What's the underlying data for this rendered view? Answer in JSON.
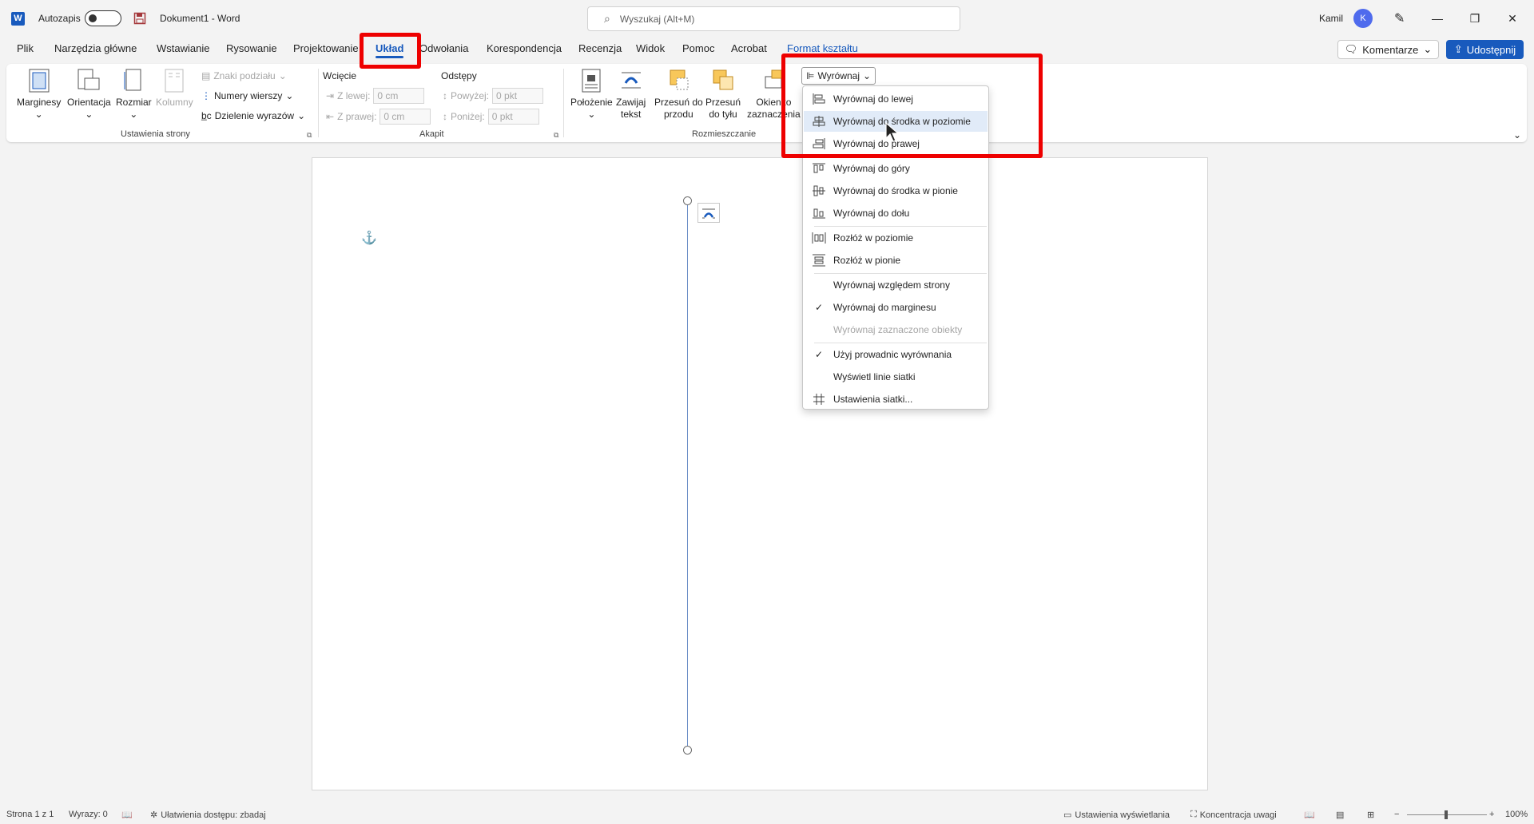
{
  "titlebar": {
    "app_logo": "W",
    "autosave_label": "Autozapis",
    "autosave_state": "off",
    "document_title": "Dokument1  -  Word",
    "search_placeholder": "Wyszukaj (Alt+M)",
    "user_name": "Kamil",
    "user_initial": "K"
  },
  "tabs": [
    {
      "label": "Plik"
    },
    {
      "label": "Narzędzia główne"
    },
    {
      "label": "Wstawianie"
    },
    {
      "label": "Rysowanie"
    },
    {
      "label": "Projektowanie"
    },
    {
      "label": "Układ",
      "active": true
    },
    {
      "label": "Odwołania"
    },
    {
      "label": "Korespondencja"
    },
    {
      "label": "Recenzja"
    },
    {
      "label": "Widok"
    },
    {
      "label": "Pomoc"
    },
    {
      "label": "Acrobat"
    },
    {
      "label": "Format kształtu",
      "contextual": true
    }
  ],
  "actions": {
    "comments": "Komentarze",
    "share": "Udostępnij"
  },
  "ribbon": {
    "page_setup": {
      "margins": "Marginesy",
      "orientation": "Orientacja",
      "size": "Rozmiar",
      "columns": "Kolumny",
      "breaks": "Znaki podziału",
      "line_numbers": "Numery wierszy",
      "hyphenation": "Dzielenie wyrazów",
      "group_label": "Ustawienia strony"
    },
    "paragraph": {
      "indent_title": "Wcięcie",
      "indent_left_label": "Z lewej:",
      "indent_left_value": "0 cm",
      "indent_right_label": "Z prawej:",
      "indent_right_value": "0 cm",
      "spacing_title": "Odstępy",
      "spacing_before_label": "Powyżej:",
      "spacing_before_value": "0 pkt",
      "spacing_after_label": "Poniżej:",
      "spacing_after_value": "0 pkt",
      "group_label": "Akapit"
    },
    "arrange": {
      "position": "Położenie",
      "wrap_text_1": "Zawijaj",
      "wrap_text_2": "tekst",
      "bring_forward_1": "Przesuń do",
      "bring_forward_2": "przodu",
      "send_backward_1": "Przesuń",
      "send_backward_2": "do tyłu",
      "selection_pane_1": "Okienko",
      "selection_pane_2": "zaznaczenia",
      "align": "Wyrównaj",
      "group_label": "Rozmieszczanie"
    }
  },
  "align_menu": {
    "items": [
      {
        "label": "Wyrównaj do lewej",
        "icon": "align-left-icon"
      },
      {
        "label": "Wyrównaj do środka w poziomie",
        "icon": "align-center-icon",
        "hover": true
      },
      {
        "label": "Wyrównaj do prawej",
        "icon": "align-right-icon"
      },
      {
        "label": "Wyrównaj do góry",
        "icon": "align-top-icon"
      },
      {
        "label": "Wyrównaj do środka w pionie",
        "icon": "align-middle-icon"
      },
      {
        "label": "Wyrównaj do dołu",
        "icon": "align-bottom-icon"
      },
      {
        "label": "Rozłóż w poziomie",
        "icon": "distribute-horizontal-icon"
      },
      {
        "label": "Rozłóż w pionie",
        "icon": "distribute-vertical-icon"
      },
      {
        "label": "Wyrównaj względem strony"
      },
      {
        "label": "Wyrównaj do marginesu",
        "checked": true
      },
      {
        "label": "Wyrównaj zaznaczone obiekty",
        "disabled": true
      },
      {
        "label": "Użyj prowadnic wyrównania",
        "checked": true
      },
      {
        "label": "Wyświetl linie siatki"
      },
      {
        "label": "Ustawienia siatki...",
        "icon": "grid-icon"
      }
    ]
  },
  "statusbar": {
    "page": "Strona 1 z 1",
    "words": "Wyrazy: 0",
    "accessibility": "Ułatwienia dostępu: zbadaj",
    "display_settings": "Ustawienia wyświetlania",
    "focus": "Koncentracja uwagi",
    "zoom": "100%"
  },
  "colors": {
    "accent": "#185abd",
    "highlight": "#ee0000"
  }
}
